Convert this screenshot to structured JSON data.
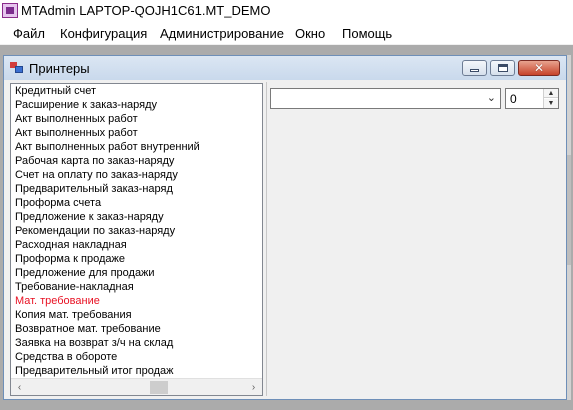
{
  "app": {
    "title": "MTAdmin LAPTOP-QOJH1C61.MT_DEMO"
  },
  "menu": {
    "items": [
      "Файл",
      "Конфигурация",
      "Администрирование",
      "Окно",
      "Помощь"
    ]
  },
  "child_window": {
    "title": "Принтеры",
    "buttons": {
      "minimize": "minimize",
      "maximize": "maximize",
      "close": "✕"
    }
  },
  "printers_list": {
    "items": [
      "Кредитный счет",
      "Расширение к заказ-наряду",
      "Акт выполненных работ",
      "Акт выполненных работ",
      "Акт выполненных работ внутренний",
      "Рабочая карта по заказ-наряду",
      "Счет на оплату по заказ-наряду",
      "Предварительный заказ-наряд",
      "Проформа счета",
      "Предложение к заказ-наряду",
      "Рекомендации по заказ-наряду",
      "Расходная накладная",
      "Проформа к продаже",
      "Предложение для продажи",
      "Требование-накладная",
      "Мат. требование",
      "Копия мат. требования",
      "Возвратное мат. требование",
      "Заявка на возврат з/ч на склад",
      "Средства в обороте",
      "Предварительный итог продаж"
    ],
    "selected_index": 15,
    "selected_color": "#e81123"
  },
  "printer_combo": {
    "value": "",
    "arrow_icon": "chevron-down-icon"
  },
  "copies": {
    "value": "0"
  },
  "scrollbar": {
    "left_icon": "‹",
    "right_icon": "›"
  }
}
